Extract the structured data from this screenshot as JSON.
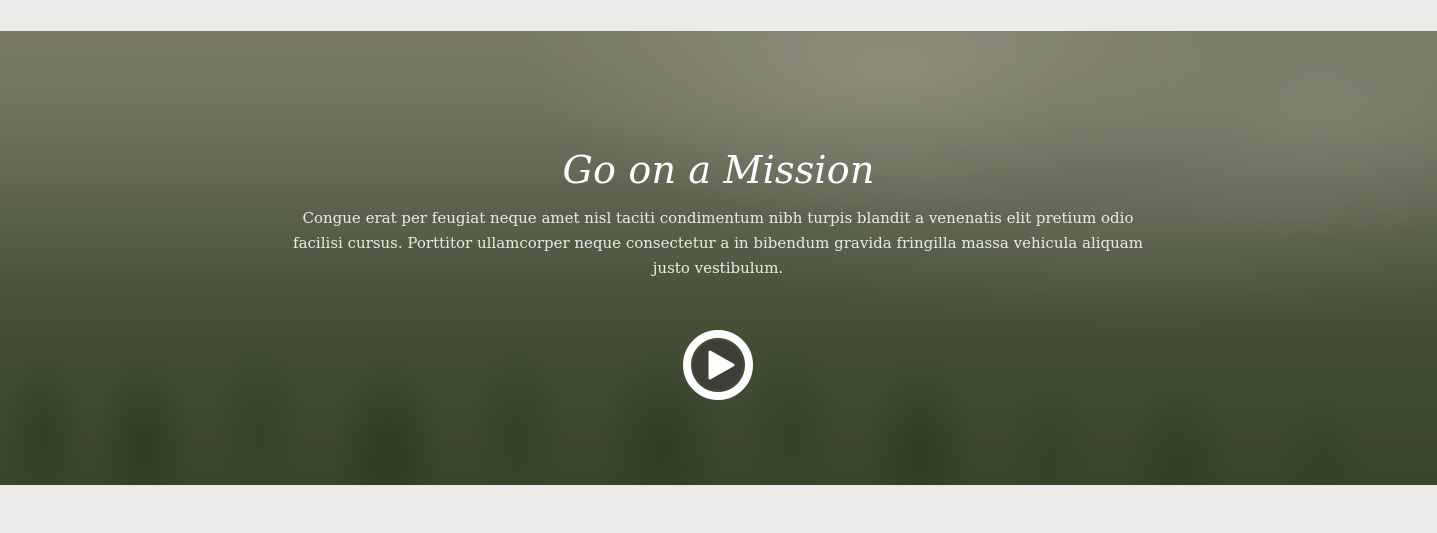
{
  "hero": {
    "title": "Go on a Mission",
    "description": "Congue erat per feugiat neque amet nisl taciti condimentum nibh turpis blandit a venenatis elit pretium odio facilisi cursus. Porttitor ullamcorper neque consectetur a in bibendum gravida fringilla massa vehicula aliquam justo vestibulum.",
    "play_icon": "play-circle-icon",
    "background": "misty-forest-image"
  },
  "colors": {
    "page_background": "#ecebe9",
    "title_text": "#ffffff",
    "body_text": "#e9e8e2",
    "play_icon": "#ffffff"
  }
}
